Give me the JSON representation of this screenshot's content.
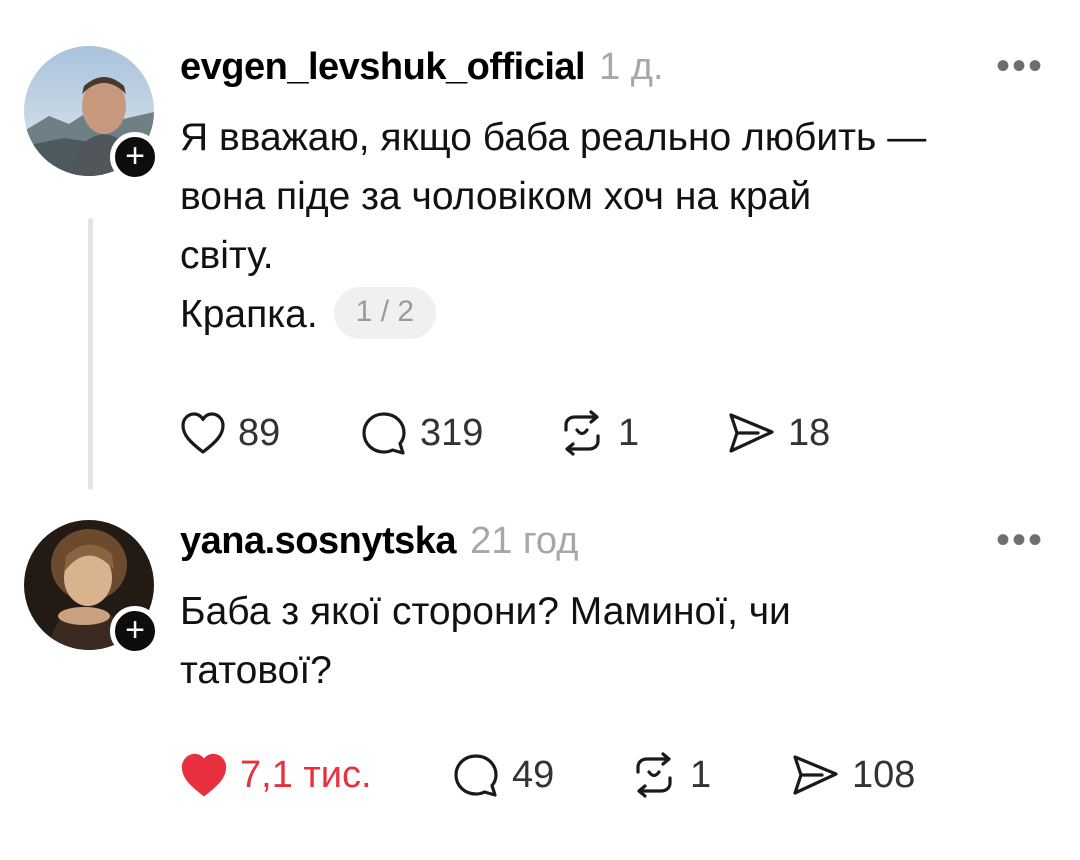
{
  "posts": [
    {
      "username": "evgen_levshuk_official",
      "time": "1 д.",
      "more": "•••",
      "lines": [
        "Я вважаю, якщо баба реально любить —",
        "вона піде за чоловіком хоч на край",
        "світу.",
        "Крапка."
      ],
      "page_indicator": "1 / 2",
      "likes": "89",
      "liked": false,
      "comments": "319",
      "reposts": "1",
      "shares": "18"
    },
    {
      "username": "yana.sosnytska",
      "time": "21 год",
      "more": "•••",
      "lines": [
        "Баба з якої сторони? Маминої, чи",
        "татової?"
      ],
      "likes": "7,1 тис.",
      "liked": true,
      "comments": "49",
      "reposts": "1",
      "shares": "108"
    }
  ],
  "colors": {
    "like_active": "#e8303f",
    "muted_text": "#a7a7a7",
    "thread_line": "#e4e4e4"
  },
  "icons": {
    "like": "heart-icon",
    "comment": "comment-bubble-icon",
    "repost": "repost-icon",
    "share": "send-icon",
    "follow": "plus-icon"
  }
}
